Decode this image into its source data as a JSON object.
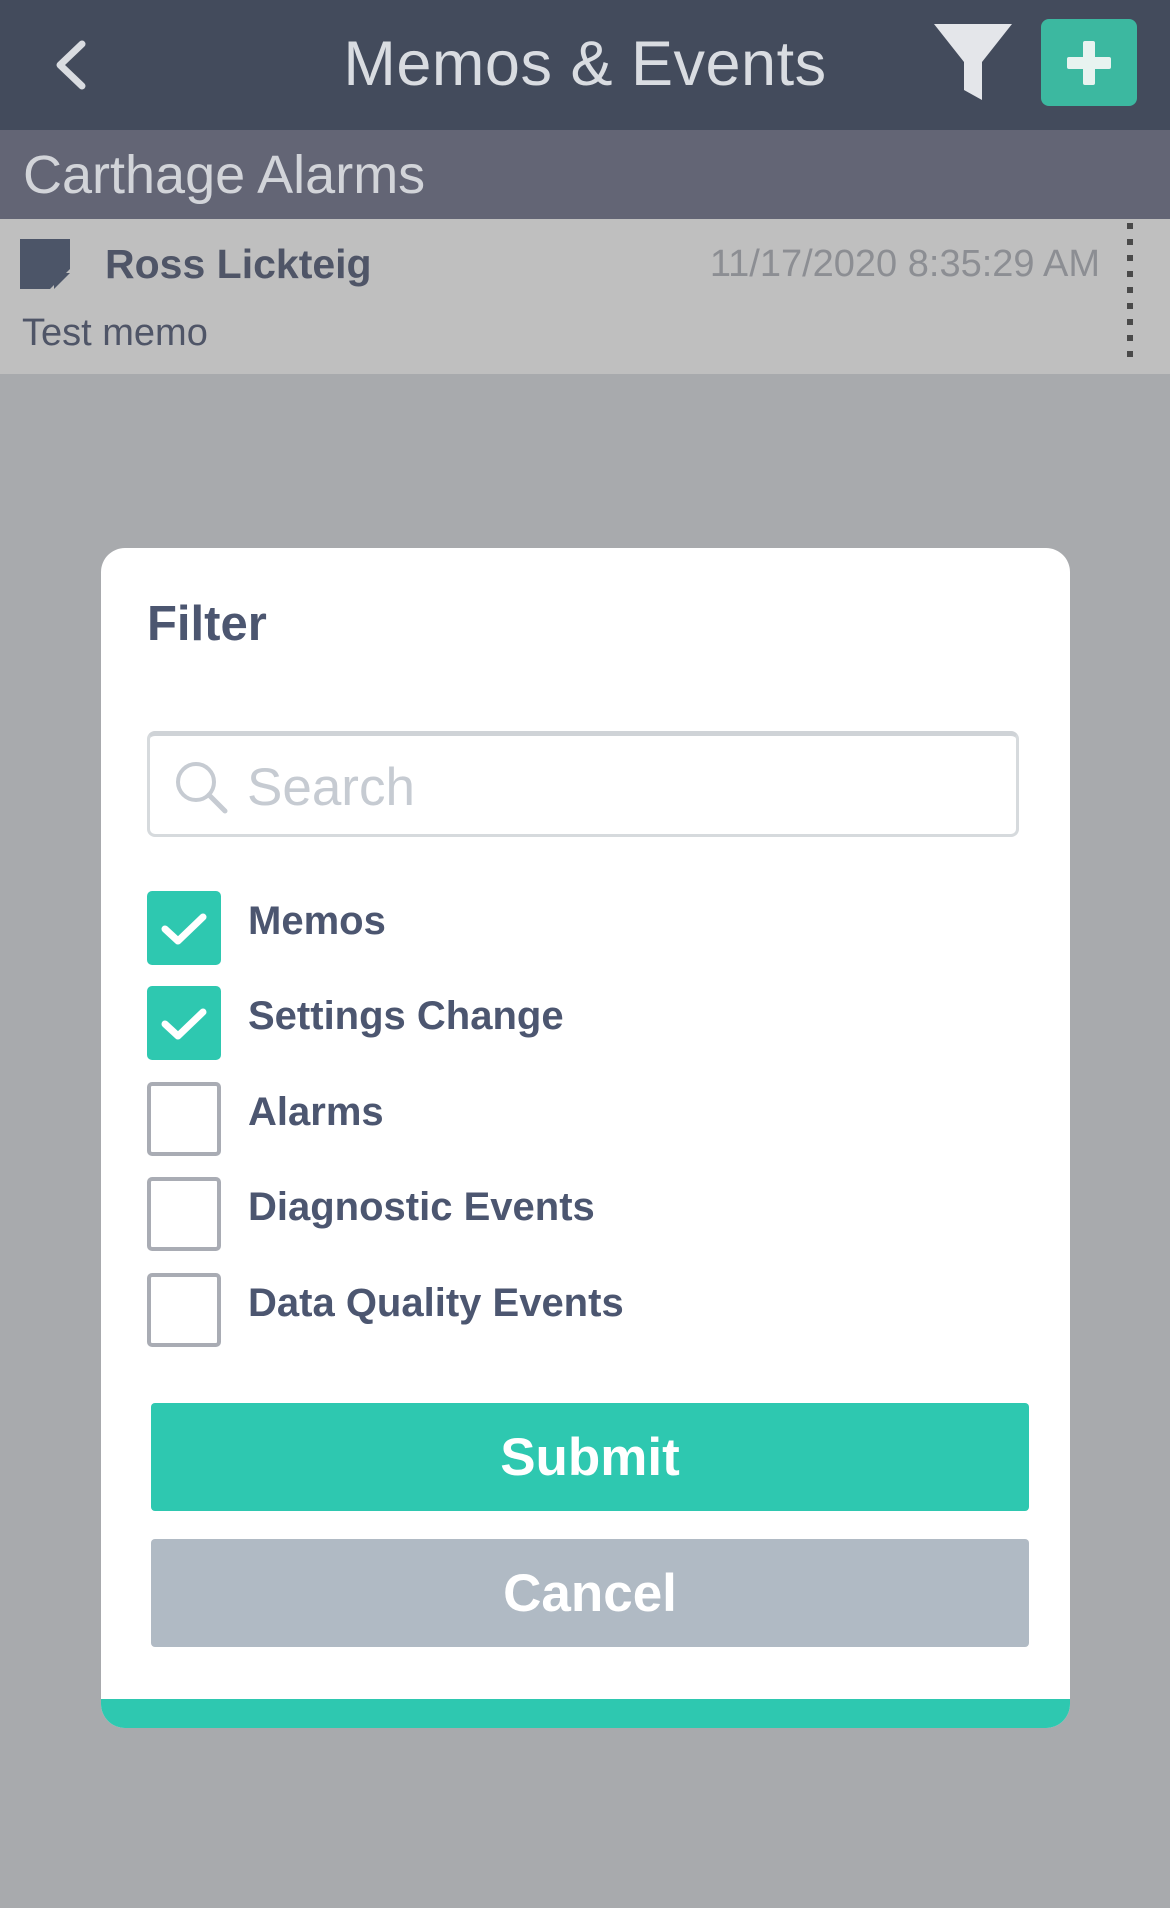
{
  "nav": {
    "title": "Memos & Events"
  },
  "subheader": {
    "title": "Carthage Alarms"
  },
  "memo": {
    "author": "Ross Lickteig",
    "timestamp": "11/17/2020 8:35:29 AM",
    "text": "Test memo"
  },
  "filter_dialog": {
    "heading": "Filter",
    "search_placeholder": "Search",
    "search_value": "",
    "options": [
      {
        "label": "Memos",
        "checked": true
      },
      {
        "label": "Settings Change",
        "checked": true
      },
      {
        "label": "Alarms",
        "checked": false
      },
      {
        "label": "Diagnostic Events",
        "checked": false
      },
      {
        "label": "Data Quality Events",
        "checked": false
      }
    ],
    "submit_label": "Submit",
    "cancel_label": "Cancel"
  },
  "colors": {
    "nav_bg": "#434b5c",
    "subheader_bg": "#636575",
    "accent": "#2ec8b0",
    "add_button": "#3cb8a0",
    "cancel_button": "#b0bac4",
    "overlay": "#a8aaad"
  },
  "icons": {
    "back": "chevron-left-icon",
    "filter": "funnel-icon",
    "add": "plus-icon",
    "memo": "note-icon",
    "more": "vertical-dots-icon",
    "search": "search-icon",
    "check": "checkmark-icon"
  }
}
